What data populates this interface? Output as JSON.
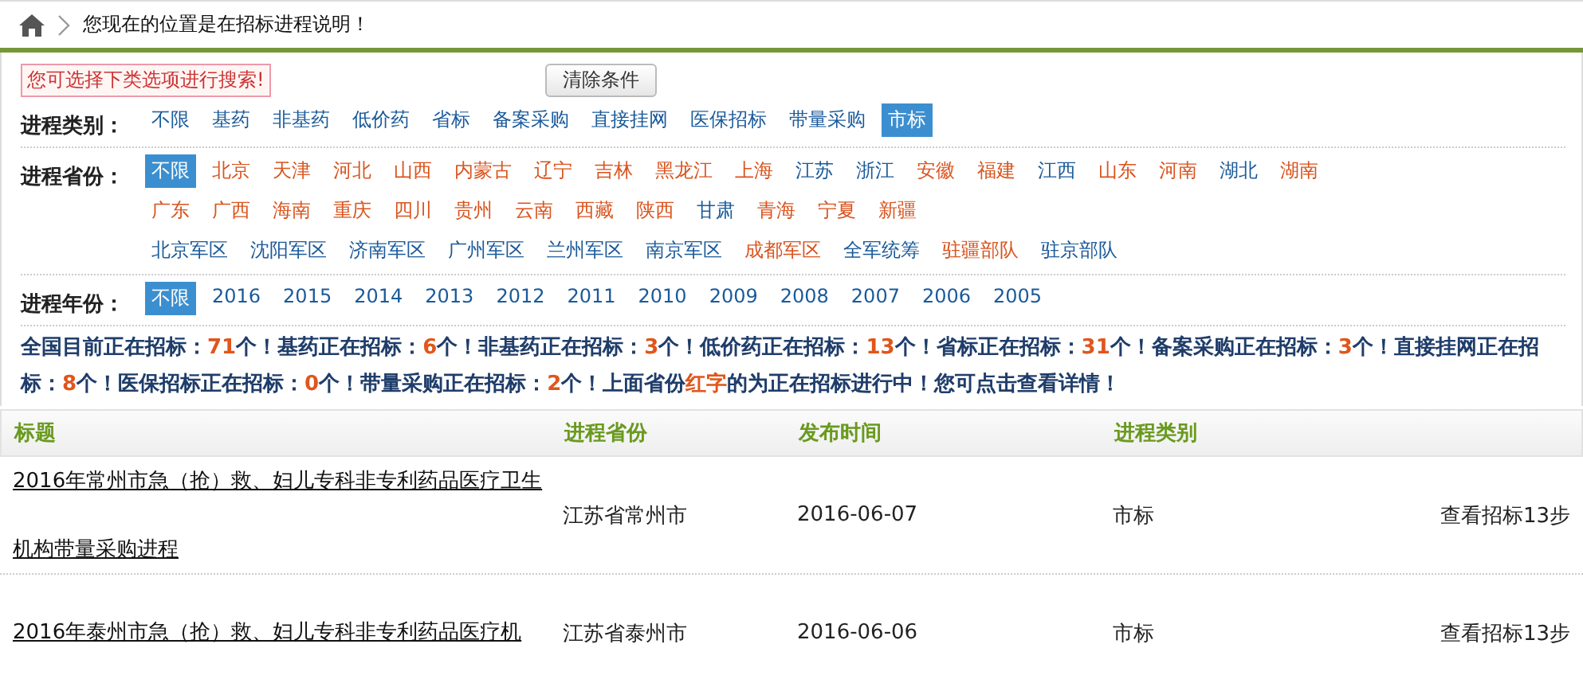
{
  "breadcrumb": {
    "text": "您现在的位置是在招标进程说明！"
  },
  "search_hint": "您可选择下类选项进行搜索!",
  "clear_button": "清除条件",
  "filters": [
    {
      "label": "进程类别：",
      "rows": [
        {
          "items": [
            {
              "text": "不限",
              "selected": false,
              "active": false
            },
            {
              "text": "基药",
              "selected": false,
              "active": false
            },
            {
              "text": "非基药",
              "selected": false,
              "active": false
            },
            {
              "text": "低价药",
              "selected": false,
              "active": false
            },
            {
              "text": "省标",
              "selected": false,
              "active": false
            },
            {
              "text": "备案采购",
              "selected": false,
              "active": false
            },
            {
              "text": "直接挂网",
              "selected": false,
              "active": false
            },
            {
              "text": "医保招标",
              "selected": false,
              "active": false
            },
            {
              "text": "带量采购",
              "selected": false,
              "active": false
            },
            {
              "text": "市标",
              "selected": true,
              "active": false
            }
          ]
        }
      ]
    },
    {
      "label": "进程省份：",
      "rows": [
        {
          "items": [
            {
              "text": "不限",
              "selected": true,
              "active": false
            },
            {
              "text": "北京",
              "selected": false,
              "active": true
            },
            {
              "text": "天津",
              "selected": false,
              "active": true
            },
            {
              "text": "河北",
              "selected": false,
              "active": true
            },
            {
              "text": "山西",
              "selected": false,
              "active": true
            },
            {
              "text": "内蒙古",
              "selected": false,
              "active": true
            },
            {
              "text": "辽宁",
              "selected": false,
              "active": true
            },
            {
              "text": "吉林",
              "selected": false,
              "active": true
            },
            {
              "text": "黑龙江",
              "selected": false,
              "active": true
            },
            {
              "text": "上海",
              "selected": false,
              "active": true
            },
            {
              "text": "江苏",
              "selected": false,
              "active": false
            },
            {
              "text": "浙江",
              "selected": false,
              "active": false
            },
            {
              "text": "安徽",
              "selected": false,
              "active": true
            },
            {
              "text": "福建",
              "selected": false,
              "active": true
            },
            {
              "text": "江西",
              "selected": false,
              "active": false
            },
            {
              "text": "山东",
              "selected": false,
              "active": true
            },
            {
              "text": "河南",
              "selected": false,
              "active": true
            },
            {
              "text": "湖北",
              "selected": false,
              "active": false
            },
            {
              "text": "湖南",
              "selected": false,
              "active": true
            }
          ]
        },
        {
          "items": [
            {
              "text": "广东",
              "selected": false,
              "active": true
            },
            {
              "text": "广西",
              "selected": false,
              "active": true
            },
            {
              "text": "海南",
              "selected": false,
              "active": true
            },
            {
              "text": "重庆",
              "selected": false,
              "active": true
            },
            {
              "text": "四川",
              "selected": false,
              "active": true
            },
            {
              "text": "贵州",
              "selected": false,
              "active": true
            },
            {
              "text": "云南",
              "selected": false,
              "active": true
            },
            {
              "text": "西藏",
              "selected": false,
              "active": true
            },
            {
              "text": "陕西",
              "selected": false,
              "active": true
            },
            {
              "text": "甘肃",
              "selected": false,
              "active": false
            },
            {
              "text": "青海",
              "selected": false,
              "active": true
            },
            {
              "text": "宁夏",
              "selected": false,
              "active": true
            },
            {
              "text": "新疆",
              "selected": false,
              "active": true
            }
          ]
        },
        {
          "items": [
            {
              "text": "北京军区",
              "selected": false,
              "active": false
            },
            {
              "text": "沈阳军区",
              "selected": false,
              "active": false
            },
            {
              "text": "济南军区",
              "selected": false,
              "active": false
            },
            {
              "text": "广州军区",
              "selected": false,
              "active": false
            },
            {
              "text": "兰州军区",
              "selected": false,
              "active": false
            },
            {
              "text": "南京军区",
              "selected": false,
              "active": false
            },
            {
              "text": "成都军区",
              "selected": false,
              "active": true
            },
            {
              "text": "全军统筹",
              "selected": false,
              "active": false
            },
            {
              "text": "驻疆部队",
              "selected": false,
              "active": true
            },
            {
              "text": "驻京部队",
              "selected": false,
              "active": false
            }
          ]
        }
      ]
    },
    {
      "label": "进程年份：",
      "rows": [
        {
          "items": [
            {
              "text": "不限",
              "selected": true,
              "active": false
            },
            {
              "text": "2016",
              "selected": false,
              "active": false
            },
            {
              "text": "2015",
              "selected": false,
              "active": false
            },
            {
              "text": "2014",
              "selected": false,
              "active": false
            },
            {
              "text": "2013",
              "selected": false,
              "active": false
            },
            {
              "text": "2012",
              "selected": false,
              "active": false
            },
            {
              "text": "2011",
              "selected": false,
              "active": false
            },
            {
              "text": "2010",
              "selected": false,
              "active": false
            },
            {
              "text": "2009",
              "selected": false,
              "active": false
            },
            {
              "text": "2008",
              "selected": false,
              "active": false
            },
            {
              "text": "2007",
              "selected": false,
              "active": false
            },
            {
              "text": "2006",
              "selected": false,
              "active": false
            },
            {
              "text": "2005",
              "selected": false,
              "active": false
            }
          ]
        }
      ]
    }
  ],
  "stats": "全国目前正在招标：**71**个！基药正在招标：**6**个！非基药正在招标：**3**个！低价药正在招标：**13**个！省标正在招标：**31**个！备案采购正在招标：**3**个！直接挂网正在招标：**8**个！医保招标正在招标：**0**个！带量采购正在招标：**2**个！上面省份**红字**的为正在招标进行中！您可点击查看详情！",
  "table": {
    "columns": [
      "标题",
      "进程省份",
      "发布时间",
      "进程类别"
    ],
    "rows": [
      {
        "title": "2016年常州市急（抢）救、妇儿专科非专利药品医疗卫生机构带量采购进程",
        "province": "江苏省常州市",
        "date": "2016-06-07",
        "type": "市标",
        "link": "查看招标13步"
      },
      {
        "title": "2016年泰州市急（抢）救、妇儿专科非专利药品医疗机",
        "province": "江苏省泰州市",
        "date": "2016-06-06",
        "type": "市标",
        "link": "查看招标13步"
      }
    ]
  }
}
